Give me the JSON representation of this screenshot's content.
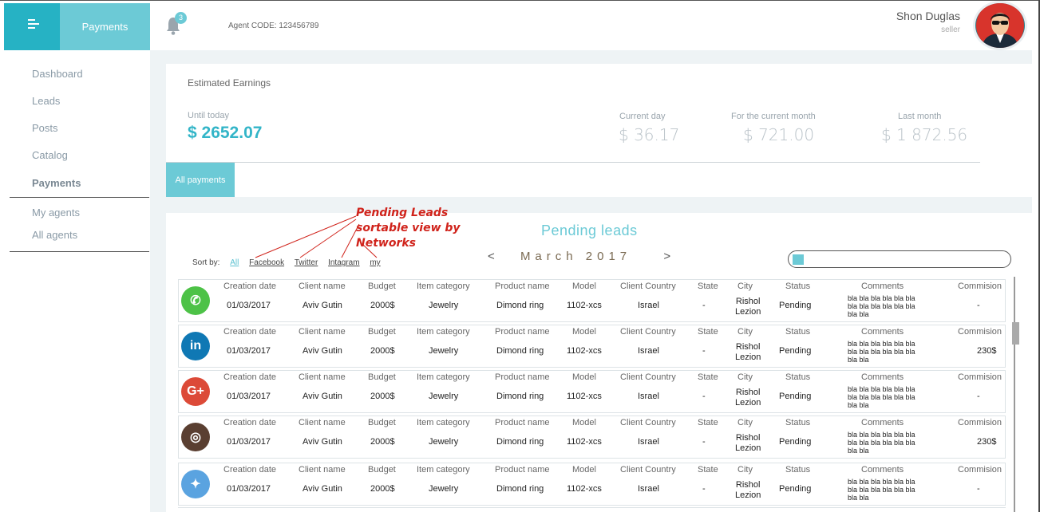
{
  "header": {
    "title": "Payments",
    "notifications_count": "3",
    "agent_code": "Agent  CODE:  123456789",
    "user_name": "Shon Duglas",
    "user_role": "seller"
  },
  "sidebar": {
    "items": [
      {
        "label": "Dashboard"
      },
      {
        "label": "Leads"
      },
      {
        "label": "Posts"
      },
      {
        "label": "Catalog"
      },
      {
        "label": "Payments"
      },
      {
        "label": "My agents"
      },
      {
        "label": "All agents"
      }
    ]
  },
  "earnings": {
    "title": "Estimated Earnings",
    "until_label": "Until today",
    "until_value": "$ 2652.07",
    "stats": [
      {
        "label": "Current day",
        "value": "$ 36.17"
      },
      {
        "label": "For the current month",
        "value": "$ 721.00"
      },
      {
        "label": "Last month",
        "value": "$ 1 872.56"
      }
    ],
    "tab": "All payments"
  },
  "pending": {
    "title": "Pending leads",
    "annotation_lines": [
      "Pending Leads",
      "sortable view by",
      "Networks"
    ],
    "sort_label": "Sort by:",
    "sort_links": [
      "All",
      "Facebook",
      "Twitter",
      "Intagram",
      "my"
    ],
    "month": "March 2017",
    "prev": "<",
    "next": ">"
  },
  "columns": [
    "Creation date",
    "Client name",
    "Budget",
    "Item category",
    "Product name",
    "Model",
    "Client Country",
    "State",
    "City",
    "Status",
    "Comments",
    "Commision"
  ],
  "rows": [
    {
      "network": "whatsapp-icon",
      "color": "#4dc247",
      "glyph": "✆",
      "date": "01/03/2017",
      "client": "Aviv Gutin",
      "budget": "2000$",
      "category": "Jewelry",
      "product": "Dimond ring",
      "model": "1102-xcs",
      "country": "Israel",
      "state": "-",
      "city1": "Rishol",
      "city2": "Lezion",
      "status": "Pending",
      "comments": "bla bla bla bla bla bla bla bla bla bla bla bla bla bla",
      "commission": "-"
    },
    {
      "network": "linkedin-icon",
      "color": "#0f78b4",
      "glyph": "in",
      "date": "01/03/2017",
      "client": "Aviv Gutin",
      "budget": "2000$",
      "category": "Jewelry",
      "product": "Dimond ring",
      "model": "1102-xcs",
      "country": "Israel",
      "state": "-",
      "city1": "Rishol",
      "city2": "Lezion",
      "status": "Pending",
      "comments": "bla bla bla bla bla bla bla bla bla bla bla bla bla bla",
      "commission": "230$"
    },
    {
      "network": "google-plus-icon",
      "color": "#dc4a38",
      "glyph": "G+",
      "date": "01/03/2017",
      "client": "Aviv Gutin",
      "budget": "2000$",
      "category": "Jewelry",
      "product": "Dimond ring",
      "model": "1102-xcs",
      "country": "Israel",
      "state": "-",
      "city1": "Rishol",
      "city2": "Lezion",
      "status": "Pending",
      "comments": "bla bla bla bla bla bla bla bla bla bla bla bla bla bla",
      "commission": "-"
    },
    {
      "network": "instagram-icon",
      "color": "#5a3f31",
      "glyph": "◎",
      "date": "01/03/2017",
      "client": "Aviv Gutin",
      "budget": "2000$",
      "category": "Jewelry",
      "product": "Dimond ring",
      "model": "1102-xcs",
      "country": "Israel",
      "state": "-",
      "city1": "Rishol",
      "city2": "Lezion",
      "status": "Pending",
      "comments": "bla bla bla bla bla bla bla bla bla bla bla bla bla bla",
      "commission": "230$"
    },
    {
      "network": "twitter-icon",
      "color": "#5aa3e0",
      "glyph": "✦",
      "date": "01/03/2017",
      "client": "Aviv Gutin",
      "budget": "2000$",
      "category": "Jewelry",
      "product": "Dimond ring",
      "model": "1102-xcs",
      "country": "Israel",
      "state": "-",
      "city1": "Rishol",
      "city2": "Lezion",
      "status": "Pending",
      "comments": "bla bla bla bla bla bla bla bla bla bla bla bla bla bla",
      "commission": "-"
    }
  ],
  "colors": {
    "accent": "#6ccad6",
    "accent_dark": "#26b2c4",
    "earnings_value": "#33b5c8",
    "annotation": "#d0231b"
  }
}
